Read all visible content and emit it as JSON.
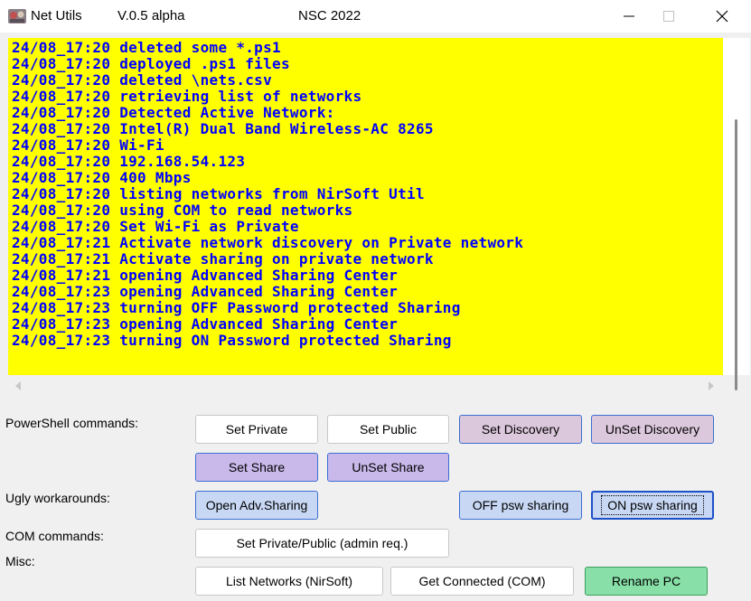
{
  "window": {
    "app_name": "Net Utils",
    "version": "V.0.5 alpha",
    "event": "NSC 2022",
    "icon": "app-icon",
    "controls": [
      "minimize-icon",
      "maximize-icon",
      "close-icon"
    ]
  },
  "log": {
    "background": "#ffff00",
    "text_color": "#0000ff",
    "lines": [
      "24/08_17:20 deleted some *.ps1",
      "24/08_17:20 deployed .ps1 files",
      "24/08_17:20 deleted \\nets.csv",
      "24/08_17:20 retrieving list of networks",
      "24/08_17:20 Detected Active Network:",
      "24/08_17:20 Intel(R) Dual Band Wireless-AC 8265",
      "24/08_17:20 Wi-Fi",
      "24/08_17:20 192.168.54.123",
      "24/08_17:20 400 Mbps",
      "24/08_17:20 listing networks from NirSoft Util",
      "24/08_17:20 using COM to read networks",
      "24/08_17:20 Set Wi-Fi as Private",
      "24/08_17:21 Activate network discovery on Private network",
      "24/08_17:21 Activate sharing on private network",
      "24/08_17:21 opening Advanced Sharing Center",
      "24/08_17:23 opening Advanced Sharing Center",
      "24/08_17:23 turning OFF Password protected Sharing",
      "24/08_17:23 opening Advanced Sharing Center",
      "24/08_17:23 turning ON Password protected Sharing"
    ]
  },
  "labels": {
    "powershell": "PowerShell commands:",
    "ugly": "Ugly workarounds:",
    "com": "COM commands:",
    "misc": "Misc:"
  },
  "buttons": {
    "set_private": "Set Private",
    "set_public": "Set Public",
    "set_discovery": "Set Discovery",
    "unset_discovery": "UnSet Discovery",
    "set_share": "Set Share",
    "unset_share": "UnSet Share",
    "open_adv_sharing": "Open Adv.Sharing",
    "off_psw_sharing": "OFF psw sharing",
    "on_psw_sharing": "ON psw sharing",
    "set_private_public_admin": "Set Private/Public (admin req.)",
    "list_networks": "List Networks (NirSoft)",
    "get_connected": "Get Connected (COM)",
    "rename_pc": "Rename PC"
  },
  "colors": {
    "lavender_button": "#c8b9ea",
    "pink_button": "#dcc8dc",
    "blue_button": "#c8d8f4",
    "green_button": "#88e0a8",
    "accent_border": "#3c6ed2"
  }
}
